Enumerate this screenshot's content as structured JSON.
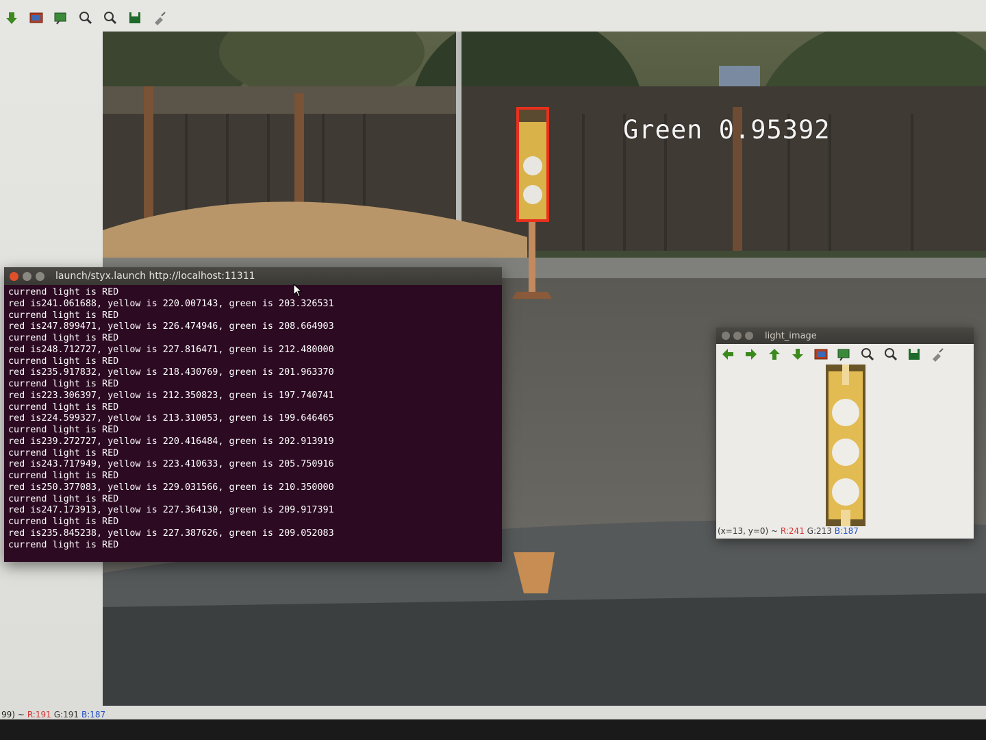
{
  "background_viewer": {
    "toolbar_icons": [
      "down-arrow-icon",
      "image-icon",
      "zoom-fit-icon",
      "zoom-in-icon",
      "zoom-out-icon",
      "save-icon",
      "clear-icon"
    ],
    "detection_label": "Green 0.95392",
    "status": {
      "coords": "99) ~ ",
      "r": "R:191",
      "g": "G:191",
      "b": "B:187"
    }
  },
  "terminal": {
    "title": "launch/styx.launch http://localhost:11311",
    "lines": [
      "currend light is RED",
      "red is241.061688, yellow is 220.007143, green is 203.326531",
      "currend light is RED",
      "red is247.899471, yellow is 226.474946, green is 208.664903",
      "currend light is RED",
      "red is248.712727, yellow is 227.816471, green is 212.480000",
      "currend light is RED",
      "red is235.917832, yellow is 218.430769, green is 201.963370",
      "currend light is RED",
      "red is223.306397, yellow is 212.350823, green is 197.740741",
      "currend light is RED",
      "red is224.599327, yellow is 213.310053, green is 199.646465",
      "currend light is RED",
      "red is239.272727, yellow is 220.416484, green is 202.913919",
      "currend light is RED",
      "red is243.717949, yellow is 223.410633, green is 205.750916",
      "currend light is RED",
      "red is250.377083, yellow is 229.031566, green is 210.350000",
      "currend light is RED",
      "red is247.173913, yellow is 227.364130, green is 209.917391",
      "currend light is RED",
      "red is235.845238, yellow is 227.387626, green is 209.052083",
      "currend light is RED"
    ]
  },
  "light_window": {
    "title": "light_image",
    "toolbar_icons": [
      "left-arrow-icon",
      "right-arrow-icon",
      "up-arrow-icon",
      "down-arrow-icon",
      "image-icon",
      "zoom-fit-icon",
      "zoom-in-icon",
      "zoom-out-icon",
      "save-icon",
      "clear-icon"
    ],
    "status": {
      "coords": "(x=13, y=0) ~ ",
      "r": "R:241",
      "g": "G:213",
      "b": "B:187"
    }
  },
  "colors": {
    "terminal_bg": "#2c0a22",
    "bbox": "#e8301e",
    "arrow_green": "#3c8a1e"
  }
}
